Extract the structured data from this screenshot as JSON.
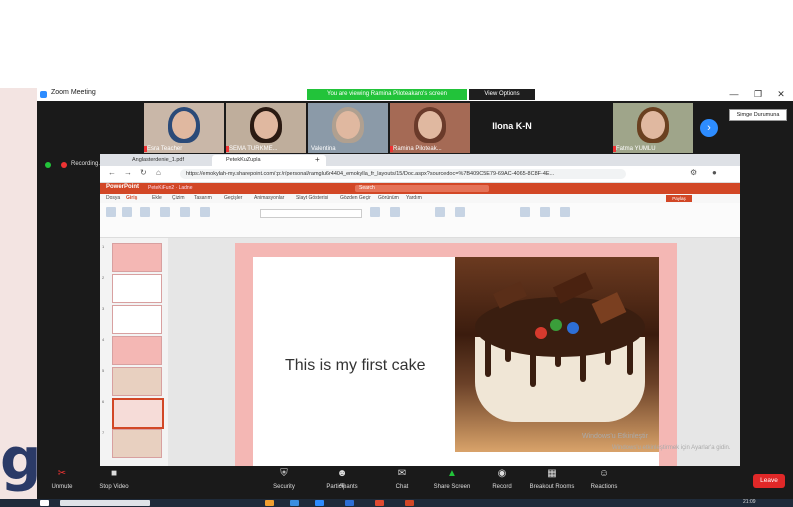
{
  "zoom": {
    "window_title": "Zoom Meeting",
    "sharing_banner": "You are viewing Ramina Piloteakaro's screen",
    "view_options": "View Options",
    "tooltip": "Simge Durumuna",
    "recording_label": "Recording...",
    "participants": [
      {
        "name": "Esra Teacher"
      },
      {
        "name": "SEMA TURKME..."
      },
      {
        "name": "Valentina"
      },
      {
        "name": "Ramina Piloteak..."
      },
      {
        "name": "Ilona K-N"
      },
      {
        "name": "Fatma YUMLU"
      }
    ],
    "toolbar": {
      "unmute": "Unmute",
      "stop_video": "Stop Video",
      "security": "Security",
      "participants": "Participants",
      "participants_count": "46",
      "chat": "Chat",
      "share_screen": "Share Screen",
      "record": "Record",
      "breakout": "Breakout Rooms",
      "reactions": "Reactions",
      "leave": "Leave"
    }
  },
  "browser": {
    "tabs": [
      {
        "label": "Anglasterdenie_1.pdf"
      },
      {
        "label": "PetekKuZupla"
      }
    ],
    "address": "https://emokylah-my.sharepoint.com/:p:/r/personal/ramglu6r4404_emokylla_fr_layouts/15/Doc.aspx?sourcedoc=%7B409C5E79-69AC-4065-8C8F-4E..."
  },
  "powerpoint": {
    "app_name": "PowerPoint",
    "file_name": "PeteKiFun2 · Ladne",
    "search": "Search",
    "ribbon_tabs": [
      "Dosya",
      "Giriş",
      "Ekle",
      "Çizim",
      "Tasarım",
      "Geçişler",
      "Animasyonlar",
      "Slayt Gösterisi",
      "Gözden Geçir",
      "Görünüm",
      "Yardım"
    ],
    "share_label": "Paylaş",
    "slide_text": "This is my first cake",
    "thumb_numbers": [
      "1",
      "2",
      "3",
      "4",
      "5",
      "6",
      "7"
    ]
  },
  "windows": {
    "watermark_1": "Windows'u Etkinleştir",
    "watermark_2": "Windows'u etkinleştirmek için Ayarlar'a gidin.",
    "clock": "21:09"
  },
  "colors": {
    "ppt_red": "#d24726",
    "zoom_blue": "#2d8cff",
    "zoom_green": "#22c33a",
    "leave_red": "#e02828",
    "slide_bg": "#f4b7b4"
  }
}
